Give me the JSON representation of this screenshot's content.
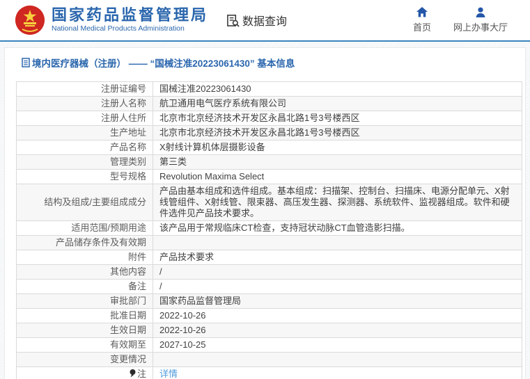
{
  "header": {
    "org_name_cn": "国家药品监督管理局",
    "org_name_en": "National Medical Products Administration",
    "data_query_label": "数据查询",
    "nav": {
      "home_label": "首页",
      "hall_label": "网上办事大厅"
    }
  },
  "breadcrumb": {
    "text": "境内医疗器械（注册） —— “国械注准20223061430” 基本信息"
  },
  "colors": {
    "brand_blue": "#2a66ad",
    "icon_blue": "#2456a8",
    "link_blue": "#4f9bdb",
    "emblem_red": "#cf2721",
    "emblem_gold": "#f7d03e",
    "row_alt_bg": "#f7f7f7",
    "table_border": "#dadada"
  },
  "table": {
    "rows": [
      {
        "label": "注册证编号",
        "value": "国械注准20223061430"
      },
      {
        "label": "注册人名称",
        "value": "航卫通用电气医疗系统有限公司"
      },
      {
        "label": "注册人住所",
        "value": "北京市北京经济技术开发区永昌北路1号3号楼西区"
      },
      {
        "label": "生产地址",
        "value": "北京市北京经济技术开发区永昌北路1号3号楼西区"
      },
      {
        "label": "产品名称",
        "value": "X射线计算机体层摄影设备"
      },
      {
        "label": "管理类别",
        "value": "第三类"
      },
      {
        "label": "型号规格",
        "value": "Revolution Maxima Select"
      },
      {
        "label": "结构及组成/主要组成成分",
        "value": "产品由基本组成和选件组成。基本组成：扫描架、控制台、扫描床、电源分配单元、X射线管组件、X射线管、限束器、高压发生器、探测器、系统软件、监视器组成。软件和硬件选件见产品技术要求。"
      },
      {
        "label": "适用范围/预期用途",
        "value": "该产品用于常规临床CT检查，支持冠状动脉CT血管造影扫描。"
      },
      {
        "label": "产品储存条件及有效期",
        "value": ""
      },
      {
        "label": "附件",
        "value": "产品技术要求"
      },
      {
        "label": "其他内容",
        "value": "/"
      },
      {
        "label": "备注",
        "value": "/"
      },
      {
        "label": "审批部门",
        "value": "国家药品监督管理局"
      },
      {
        "label": "批准日期",
        "value": "2022-10-26"
      },
      {
        "label": "生效日期",
        "value": "2022-10-26"
      },
      {
        "label": "有效期至",
        "value": "2027-10-25"
      },
      {
        "label": "变更情况",
        "value": ""
      },
      {
        "label": "注",
        "value": "详情",
        "link": true,
        "note_icon": true
      }
    ]
  }
}
